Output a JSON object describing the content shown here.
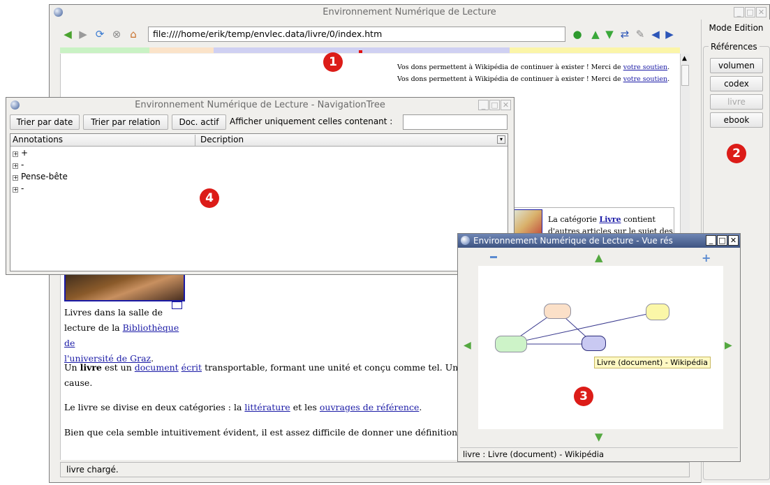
{
  "main_window": {
    "title": "Environnement Numérique de Lecture",
    "url": "file:////home/erik/temp/envlec.data/livre/0/index.htm",
    "status": "livre chargé.",
    "notice_1": "Vos dons permettent à Wikipédia de continuer à exister ! Merci de",
    "notice_link": "votre soutien",
    "notice_end": ".",
    "category_text_1": "La catégorie",
    "category_link": "Livre",
    "category_text_2": "contient",
    "category_text_3": "d'autres articles sur le sujet des",
    "caption_1": "Livres dans la salle de",
    "caption_2": "lecture de la",
    "caption_link_1": "Bibliothèque de",
    "caption_link_2": "l'université de Graz",
    "caption_end": ".",
    "p1_a": "Un",
    "p1_bold": "livre",
    "p1_b": "est un",
    "p1_link1": "document",
    "p1_link2": "écrit",
    "p1_c": "transportable, formant une unité et conçu comme tel. Une telle de",
    "p1_d": "cause.",
    "p2_a": "Le livre se divise en deux catégories : la",
    "p2_link1": "littérature",
    "p2_b": "et les",
    "p2_link2": "ouvrages de référence",
    "p2_c": ".",
    "p3": "Bien que cela semble intuitivement évident, il est assez difficile de donner une définition précise"
  },
  "side_panel": {
    "mode_button": "Mode Edition",
    "group_label": "Références",
    "buttons": [
      "volumen",
      "codex",
      "livre",
      "ebook"
    ]
  },
  "nav_tree": {
    "title": "Environnement Numérique de Lecture - NavigationTree",
    "buttons": [
      "Trier par date",
      "Trier par relation",
      "Doc. actif"
    ],
    "filter_label": "Afficher uniquement celles contenant :",
    "filter_value": "",
    "columns": [
      "Annotations",
      "Decription"
    ],
    "rows": [
      "+",
      "-",
      "Pense-bête",
      "-"
    ]
  },
  "graph_view": {
    "title": "Environnement Numérique de Lecture - Vue rés",
    "tooltip": "Livre (document) - Wikipédia",
    "status": "livre : Livre (document) - Wikipédia",
    "node_colors": [
      "#fbe0c8",
      "#fbf7a8",
      "#cdf3c8",
      "#c9c9f2"
    ]
  },
  "markers": [
    "1",
    "2",
    "3",
    "4"
  ],
  "colors": {
    "marker_red": "#dc1c18",
    "link_blue": "#1a1aa6",
    "bar_green": "#c9f2c4",
    "bar_peach": "#fbe3c9",
    "bar_lavender": "#cfd0f2",
    "bar_yellow": "#fbf5a8"
  }
}
